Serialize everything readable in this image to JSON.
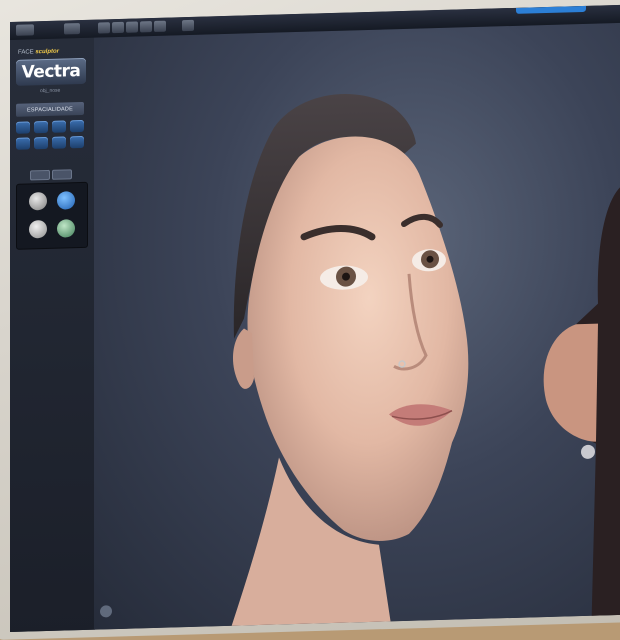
{
  "app": {
    "brand_line": "FACE",
    "brand_product": "sculptor",
    "logo_text": "Vectra",
    "version": "obj_nose"
  },
  "panel": {
    "section_label": "ESPACIALIDADE"
  },
  "colors": {
    "accent_blue": "#2c7fd6",
    "tool_blue": "#3b6fb0",
    "viewport_bg": "#3c4458",
    "brand_gold": "#f0c94a"
  },
  "icons": {
    "toolbar": [
      "view-icon",
      "rotate-icon",
      "pan-icon",
      "zoom-icon",
      "measure-icon",
      "settings-icon"
    ],
    "bottom": "sculpt-icon"
  }
}
